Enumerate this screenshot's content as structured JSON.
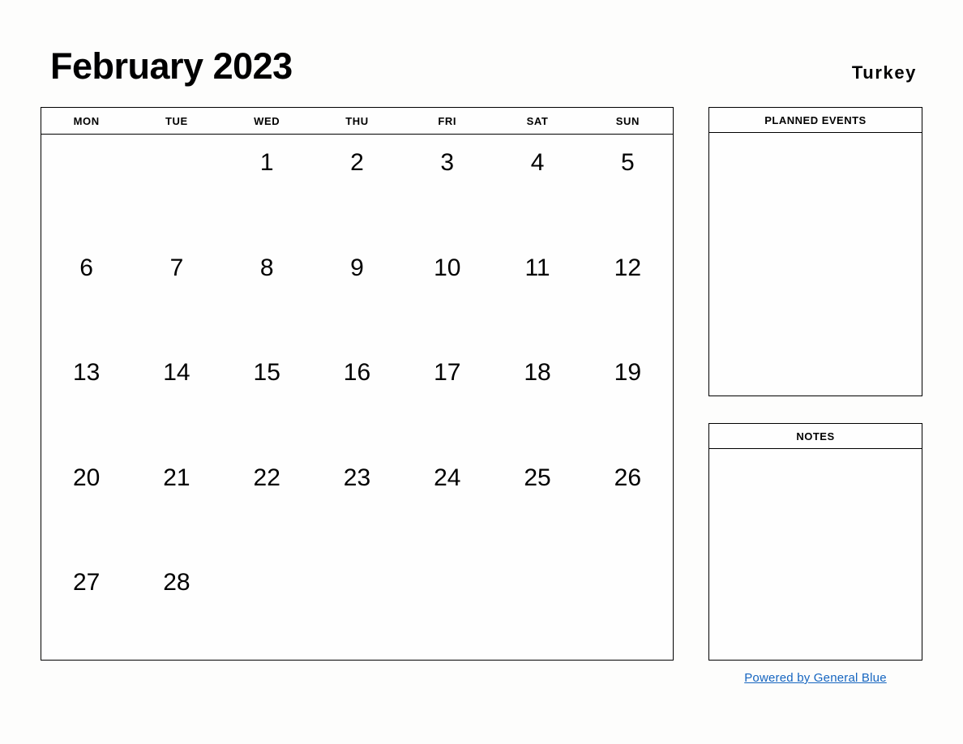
{
  "header": {
    "month_title": "February 2023",
    "country": "Turkey"
  },
  "calendar": {
    "weekday_headers": [
      "MON",
      "TUE",
      "WED",
      "THU",
      "FRI",
      "SAT",
      "SUN"
    ],
    "weeks": [
      [
        "",
        "",
        "1",
        "2",
        "3",
        "4",
        "5"
      ],
      [
        "6",
        "7",
        "8",
        "9",
        "10",
        "11",
        "12"
      ],
      [
        "13",
        "14",
        "15",
        "16",
        "17",
        "18",
        "19"
      ],
      [
        "20",
        "21",
        "22",
        "23",
        "24",
        "25",
        "26"
      ],
      [
        "27",
        "28",
        "",
        "",
        "",
        "",
        ""
      ]
    ]
  },
  "panels": {
    "planned_events": {
      "title": "PLANNED EVENTS",
      "content": ""
    },
    "notes": {
      "title": "NOTES",
      "content": ""
    }
  },
  "footer": {
    "powered_by": "Powered by General Blue"
  },
  "colors": {
    "page_background": "#fdfdfc",
    "border": "#000000",
    "text": "#000000",
    "link": "#1565c0"
  }
}
